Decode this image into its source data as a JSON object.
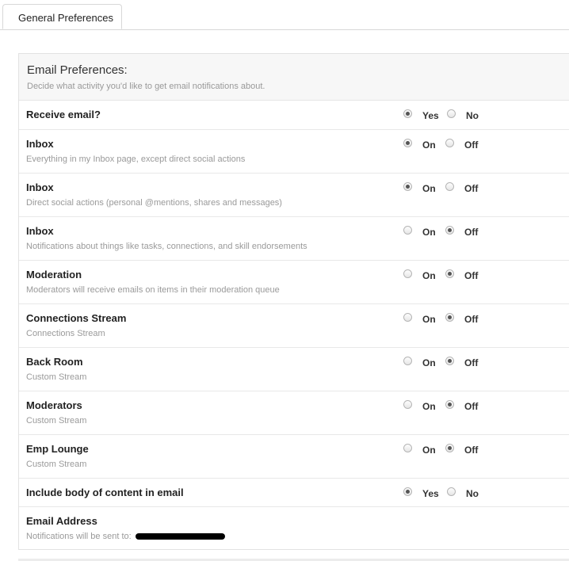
{
  "tabs": [
    {
      "label": "General Preferences"
    }
  ],
  "email_prefs": {
    "title": "Email Preferences:",
    "subtitle": "Decide what activity you'd like to get email notifications about."
  },
  "rows": [
    {
      "title": "Receive email?",
      "desc": "",
      "opt1": "Yes",
      "opt2": "No",
      "selected": "Yes"
    },
    {
      "title": "Inbox",
      "desc": "Everything in my Inbox page, except direct social actions",
      "opt1": "On",
      "opt2": "Off",
      "selected": "On"
    },
    {
      "title": "Inbox",
      "desc": "Direct social actions (personal @mentions, shares and messages)",
      "opt1": "On",
      "opt2": "Off",
      "selected": "On"
    },
    {
      "title": "Inbox",
      "desc": "Notifications about things like tasks, connections, and skill endorsements",
      "opt1": "On",
      "opt2": "Off",
      "selected": "Off"
    },
    {
      "title": "Moderation",
      "desc": "Moderators will receive emails on items in their moderation queue",
      "opt1": "On",
      "opt2": "Off",
      "selected": "Off"
    },
    {
      "title": "Connections Stream",
      "desc": "Connections Stream",
      "opt1": "On",
      "opt2": "Off",
      "selected": "Off"
    },
    {
      "title": "Back Room",
      "desc": "Custom Stream",
      "opt1": "On",
      "opt2": "Off",
      "selected": "Off"
    },
    {
      "title": "Moderators",
      "desc": "Custom Stream",
      "opt1": "On",
      "opt2": "Off",
      "selected": "Off"
    },
    {
      "title": "Emp Lounge",
      "desc": "Custom Stream",
      "opt1": "On",
      "opt2": "Off",
      "selected": "Off"
    },
    {
      "title": "Include body of content in email",
      "desc": "",
      "opt1": "Yes",
      "opt2": "No",
      "selected": "Yes"
    }
  ],
  "email_address": {
    "title": "Email Address",
    "desc": "Notifications will be sent to:"
  }
}
